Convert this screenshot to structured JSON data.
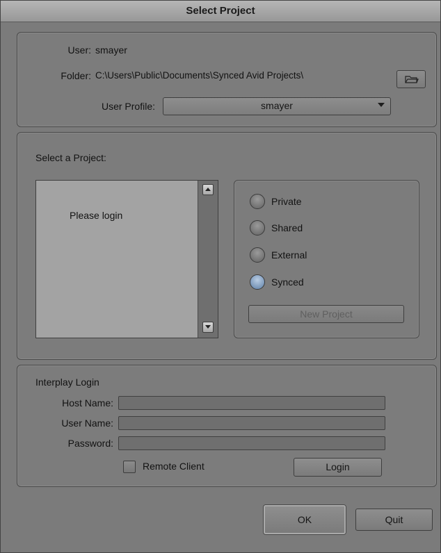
{
  "window": {
    "title": "Select Project"
  },
  "top": {
    "user_label": "User:",
    "user_value": "smayer",
    "folder_label": "Folder:",
    "folder_value": "C:\\Users\\Public\\Documents\\Synced Avid Projects\\",
    "profile_label": "User Profile:",
    "profile_value": "smayer"
  },
  "project": {
    "heading": "Select a Project:",
    "list_message": "Please login",
    "options": [
      {
        "label": "Private",
        "selected": false
      },
      {
        "label": "Shared",
        "selected": false
      },
      {
        "label": "External",
        "selected": false
      },
      {
        "label": "Synced",
        "selected": true
      }
    ],
    "new_project_label": "New Project"
  },
  "interplay": {
    "heading": "Interplay Login",
    "host_label": "Host Name:",
    "host_value": "",
    "user_label": "User Name:",
    "user_value": "",
    "password_label": "Password:",
    "password_value": "",
    "remote_client_label": "Remote Client",
    "remote_client_checked": false,
    "login_label": "Login"
  },
  "footer": {
    "ok_label": "OK",
    "quit_label": "Quit"
  },
  "icons": {
    "folder_browse": "folder-open-icon"
  }
}
